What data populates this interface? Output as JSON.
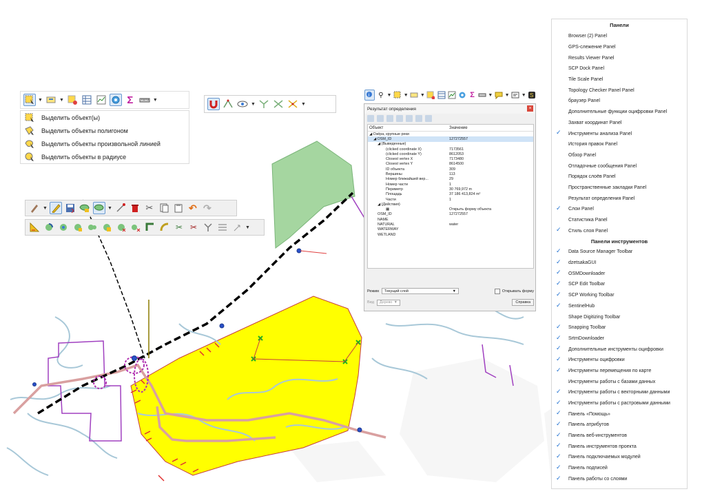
{
  "select_menu": {
    "items": [
      {
        "label": "Выделить объект(ы)",
        "icon": "select-rect-icon"
      },
      {
        "label": "Выделить объекты полигоном",
        "icon": "select-polygon-icon"
      },
      {
        "label": "Выделить объекты произвольной линией",
        "icon": "select-freehand-icon"
      },
      {
        "label": "Выделить объекты в радиусе",
        "icon": "select-radius-icon"
      }
    ]
  },
  "identify": {
    "title": "Результат определения",
    "col_object": "Объект",
    "col_value": "Значение",
    "rows": [
      {
        "k": "◢ Озёра, крупные реки",
        "v": "",
        "ind": 0
      },
      {
        "k": "◢ OSM_ID",
        "v": "127272557",
        "ind": 1,
        "sel": true
      },
      {
        "k": "◢ (Выведенные)",
        "v": "",
        "ind": 2
      },
      {
        "k": "(clicked coordinate X)",
        "v": "7173561",
        "ind": 4
      },
      {
        "k": "(clicked coordinate Y)",
        "v": "8612053",
        "ind": 4
      },
      {
        "k": "Closest vertex X",
        "v": "7173480",
        "ind": 4
      },
      {
        "k": "Closest vertex Y",
        "v": "8614500",
        "ind": 4
      },
      {
        "k": "ID объекта",
        "v": "309",
        "ind": 4
      },
      {
        "k": "Вершины",
        "v": "113",
        "ind": 4
      },
      {
        "k": "Номер ближайшей вер...",
        "v": "29",
        "ind": 4
      },
      {
        "k": "Номер части",
        "v": "1",
        "ind": 4
      },
      {
        "k": "Периметр",
        "v": "30 769,972 m",
        "ind": 4
      },
      {
        "k": "Площадь",
        "v": "37 186 413,824 m²",
        "ind": 4
      },
      {
        "k": "Части",
        "v": "1",
        "ind": 4
      },
      {
        "k": "◢ (Действия)",
        "v": "",
        "ind": 2
      },
      {
        "k": "▦",
        "v": "Открыть форму объекта",
        "ind": 4
      },
      {
        "k": "OSM_ID",
        "v": "127272557",
        "ind": 2
      },
      {
        "k": "NAME",
        "v": "",
        "ind": 2
      },
      {
        "k": "NATURAL",
        "v": "water",
        "ind": 2
      },
      {
        "k": "WATERWAY",
        "v": "",
        "ind": 2
      },
      {
        "k": "WETLAND",
        "v": "",
        "ind": 2
      }
    ],
    "mode_label": "Режим",
    "mode_value": "Текущий слой",
    "open_form": "Открывать форму",
    "view_label": "Вид",
    "view_value": "Дерево",
    "help": "Справка"
  },
  "panels_menu": {
    "header_panels": "Панели",
    "panels": [
      {
        "label": "Browser (2) Panel",
        "checked": false
      },
      {
        "label": "GPS-слежение Panel",
        "checked": false
      },
      {
        "label": "Results Viewer Panel",
        "checked": false
      },
      {
        "label": "SCP Dock Panel",
        "checked": false
      },
      {
        "label": "Tile Scale Panel",
        "checked": false
      },
      {
        "label": "Topology Checker Panel Panel",
        "checked": false
      },
      {
        "label": "браузер Panel",
        "checked": false
      },
      {
        "label": "Дополнительные функции оцифровки Panel",
        "checked": false
      },
      {
        "label": "Захват координат Panel",
        "checked": false
      },
      {
        "label": "Инструменты анализа Panel",
        "checked": true
      },
      {
        "label": "История правок Panel",
        "checked": false
      },
      {
        "label": "Обзор Panel",
        "checked": false
      },
      {
        "label": "Отладочные сообщения Panel",
        "checked": false
      },
      {
        "label": "Порядок слоёв Panel",
        "checked": false
      },
      {
        "label": "Пространственные закладки Panel",
        "checked": false
      },
      {
        "label": "Результат определения Panel",
        "checked": false
      },
      {
        "label": "Слои Panel",
        "checked": true
      },
      {
        "label": "Статистика Panel",
        "checked": false
      },
      {
        "label": "Стиль слоя Panel",
        "checked": true
      }
    ],
    "header_toolbars": "Панели инструментов",
    "toolbars": [
      {
        "label": "Data Source Manager Toolbar",
        "checked": true
      },
      {
        "label": "dzetsakaGUI",
        "checked": true
      },
      {
        "label": "OSMDownloader",
        "checked": true
      },
      {
        "label": "SCP Edit Toolbar",
        "checked": true
      },
      {
        "label": "SCP Working Toolbar",
        "checked": true
      },
      {
        "label": "SentinelHub",
        "checked": true
      },
      {
        "label": "Shape Digitizing Toolbar",
        "checked": false
      },
      {
        "label": "Snapping Toolbar",
        "checked": true
      },
      {
        "label": "SrtmDownloader",
        "checked": true
      },
      {
        "label": "Дополнительные инструменты оцифровки",
        "checked": true
      },
      {
        "label": "Инструменты оцифровки",
        "checked": true
      },
      {
        "label": "Инструменты перемещения по карте",
        "checked": true
      },
      {
        "label": "Инструменты работы с базами данных",
        "checked": false
      },
      {
        "label": "Инструменты работы с векторными данными",
        "checked": true
      },
      {
        "label": "Инструменты работы с растровыми данными",
        "checked": true
      },
      {
        "label": "Панель «Помощь»",
        "checked": true
      },
      {
        "label": "Панель атрибутов",
        "checked": true
      },
      {
        "label": "Панель веб-инструментов",
        "checked": true
      },
      {
        "label": "Панель инструментов проекта",
        "checked": true
      },
      {
        "label": "Панель подключаемых модулей",
        "checked": true
      },
      {
        "label": "Панель подписей",
        "checked": true
      },
      {
        "label": "Панель работы со слоями",
        "checked": true
      }
    ]
  },
  "colors": {
    "polygon_fill": "#ffff00",
    "road": "#d9a0a0",
    "boundary": "#a040c0",
    "river": "#a8c8d8",
    "forest": "#a5d6a0"
  }
}
